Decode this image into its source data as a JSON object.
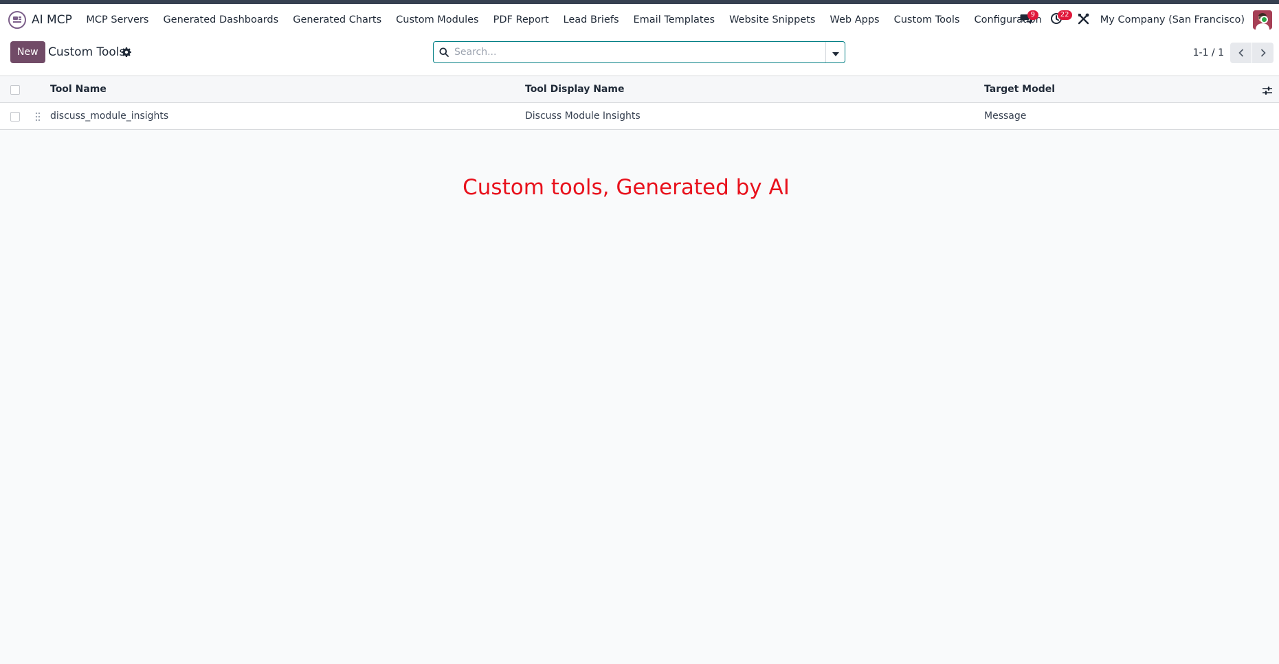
{
  "app": {
    "name": "AI MCP",
    "logo_icon": "ai-mcp-logo-icon"
  },
  "nav": {
    "items": [
      {
        "label": "MCP Servers"
      },
      {
        "label": "Generated Dashboards"
      },
      {
        "label": "Generated Charts"
      },
      {
        "label": "Custom Modules"
      },
      {
        "label": "PDF Report"
      },
      {
        "label": "Lead Briefs"
      },
      {
        "label": "Email Templates"
      },
      {
        "label": "Website Snippets"
      },
      {
        "label": "Web Apps"
      },
      {
        "label": "Custom Tools"
      },
      {
        "label": "Configuration"
      }
    ]
  },
  "systray": {
    "messages_badge": "9",
    "activities_badge": "22",
    "company": "My Company (San Francisco)"
  },
  "control": {
    "new_label": "New",
    "title": "Custom Tools",
    "search_placeholder": "Search...",
    "pager": "1-1 / 1"
  },
  "table": {
    "columns": [
      "Tool Name",
      "Tool Display Name",
      "Target Model"
    ],
    "rows": [
      [
        "discuss_module_insights",
        "Discuss Module Insights",
        "Message"
      ]
    ]
  },
  "helper": {
    "text": "Custom tools, Generated by AI"
  },
  "colors": {
    "brand": "#714b67",
    "search_border": "#017e84",
    "badge": "#e0193b",
    "helper_text": "#e8111c"
  }
}
